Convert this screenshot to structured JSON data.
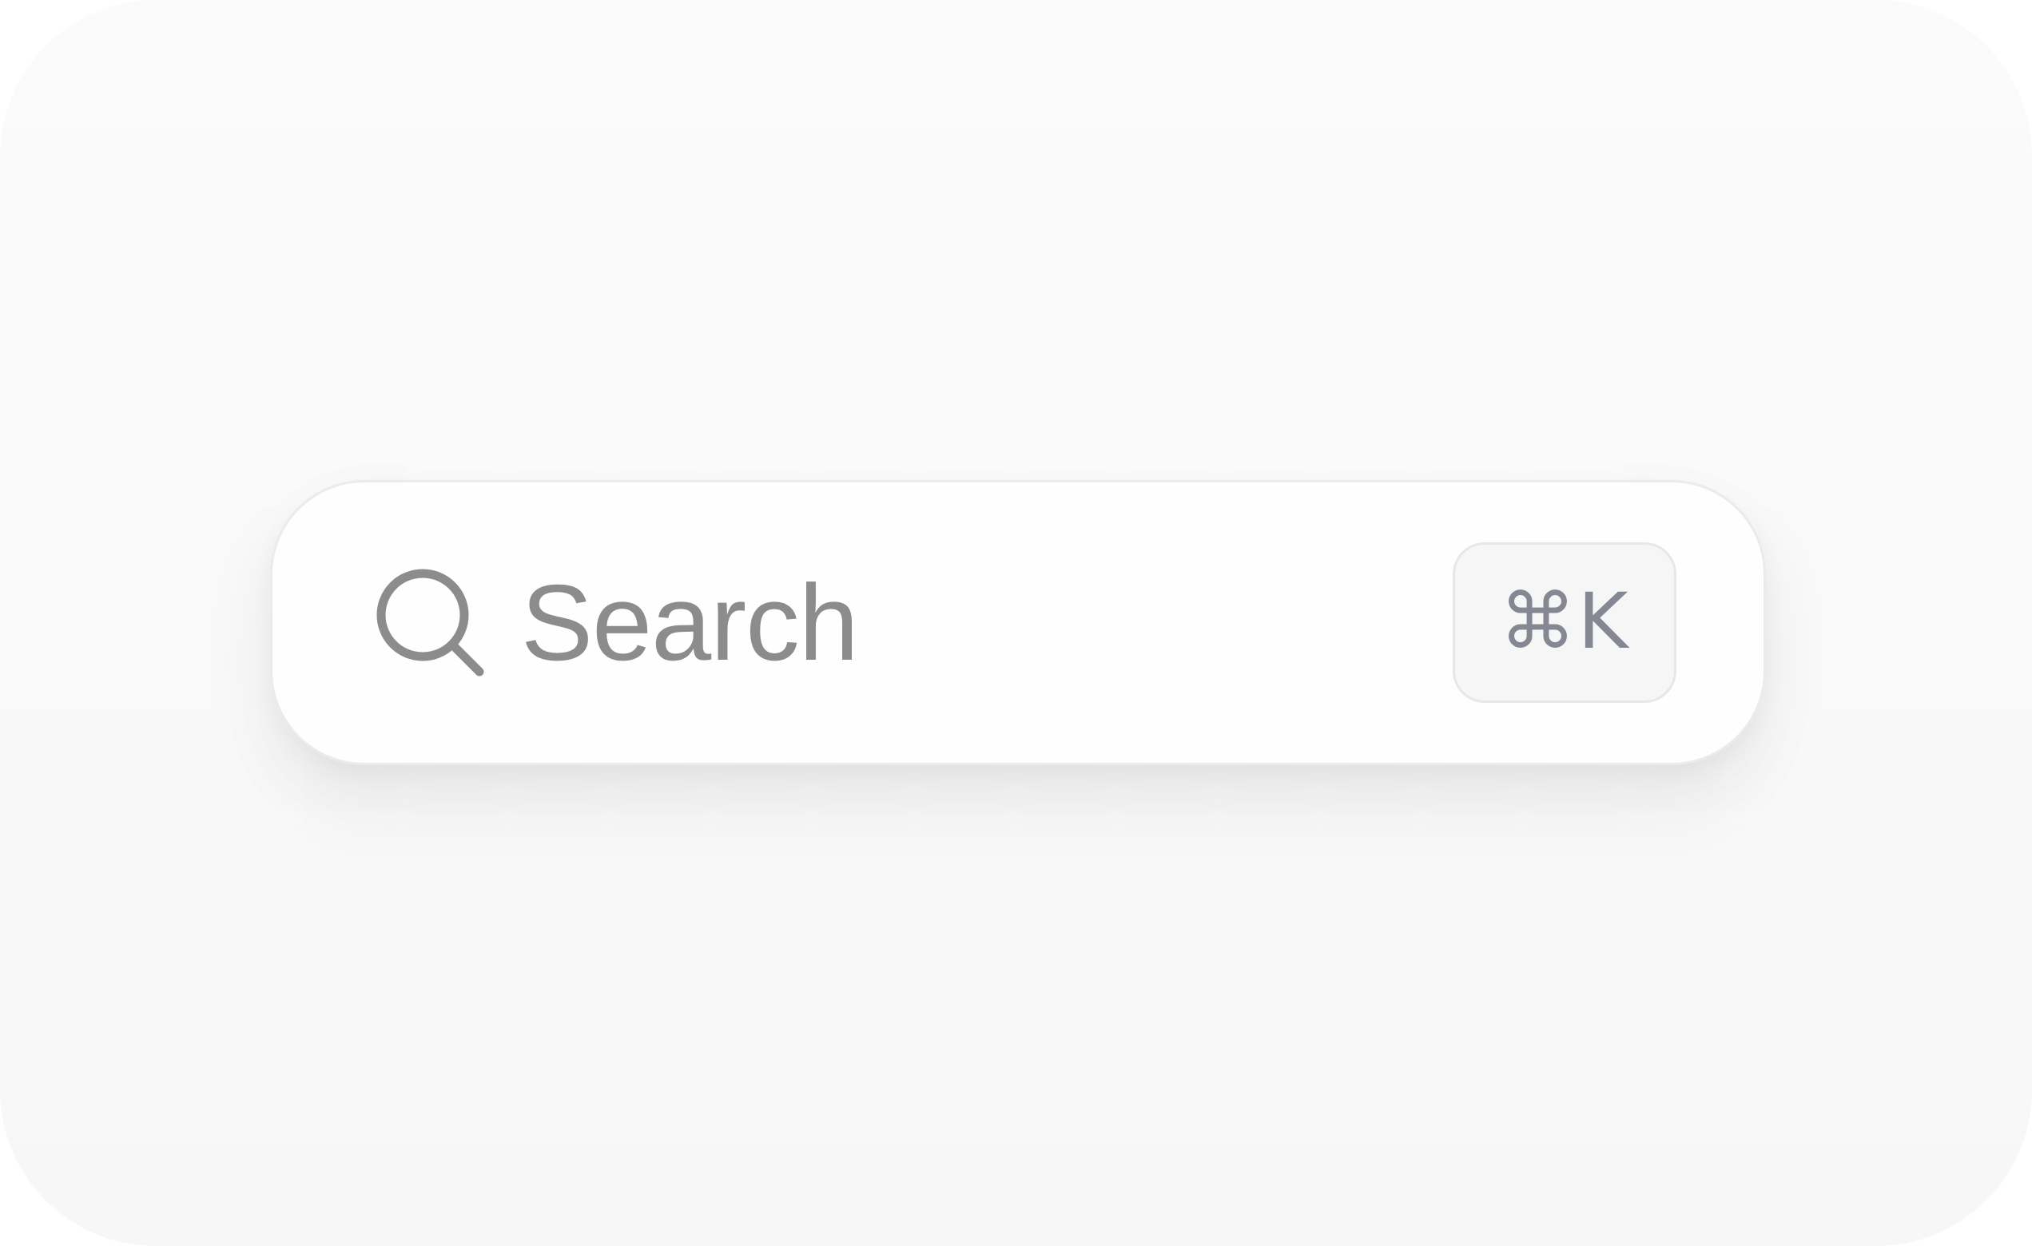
{
  "search": {
    "placeholder": "Search",
    "value": "",
    "icon": "search-icon",
    "shortcut_label": "⌘K"
  },
  "colors": {
    "background": "#f9f9f9",
    "field_background": "#fefefe",
    "field_border": "#ebebeb",
    "placeholder_text": "#8c8c8c",
    "icon": "#8c8c8c",
    "shortcut_background": "#f6f6f7",
    "shortcut_border": "#e7e7e9",
    "shortcut_text": "#858792"
  }
}
